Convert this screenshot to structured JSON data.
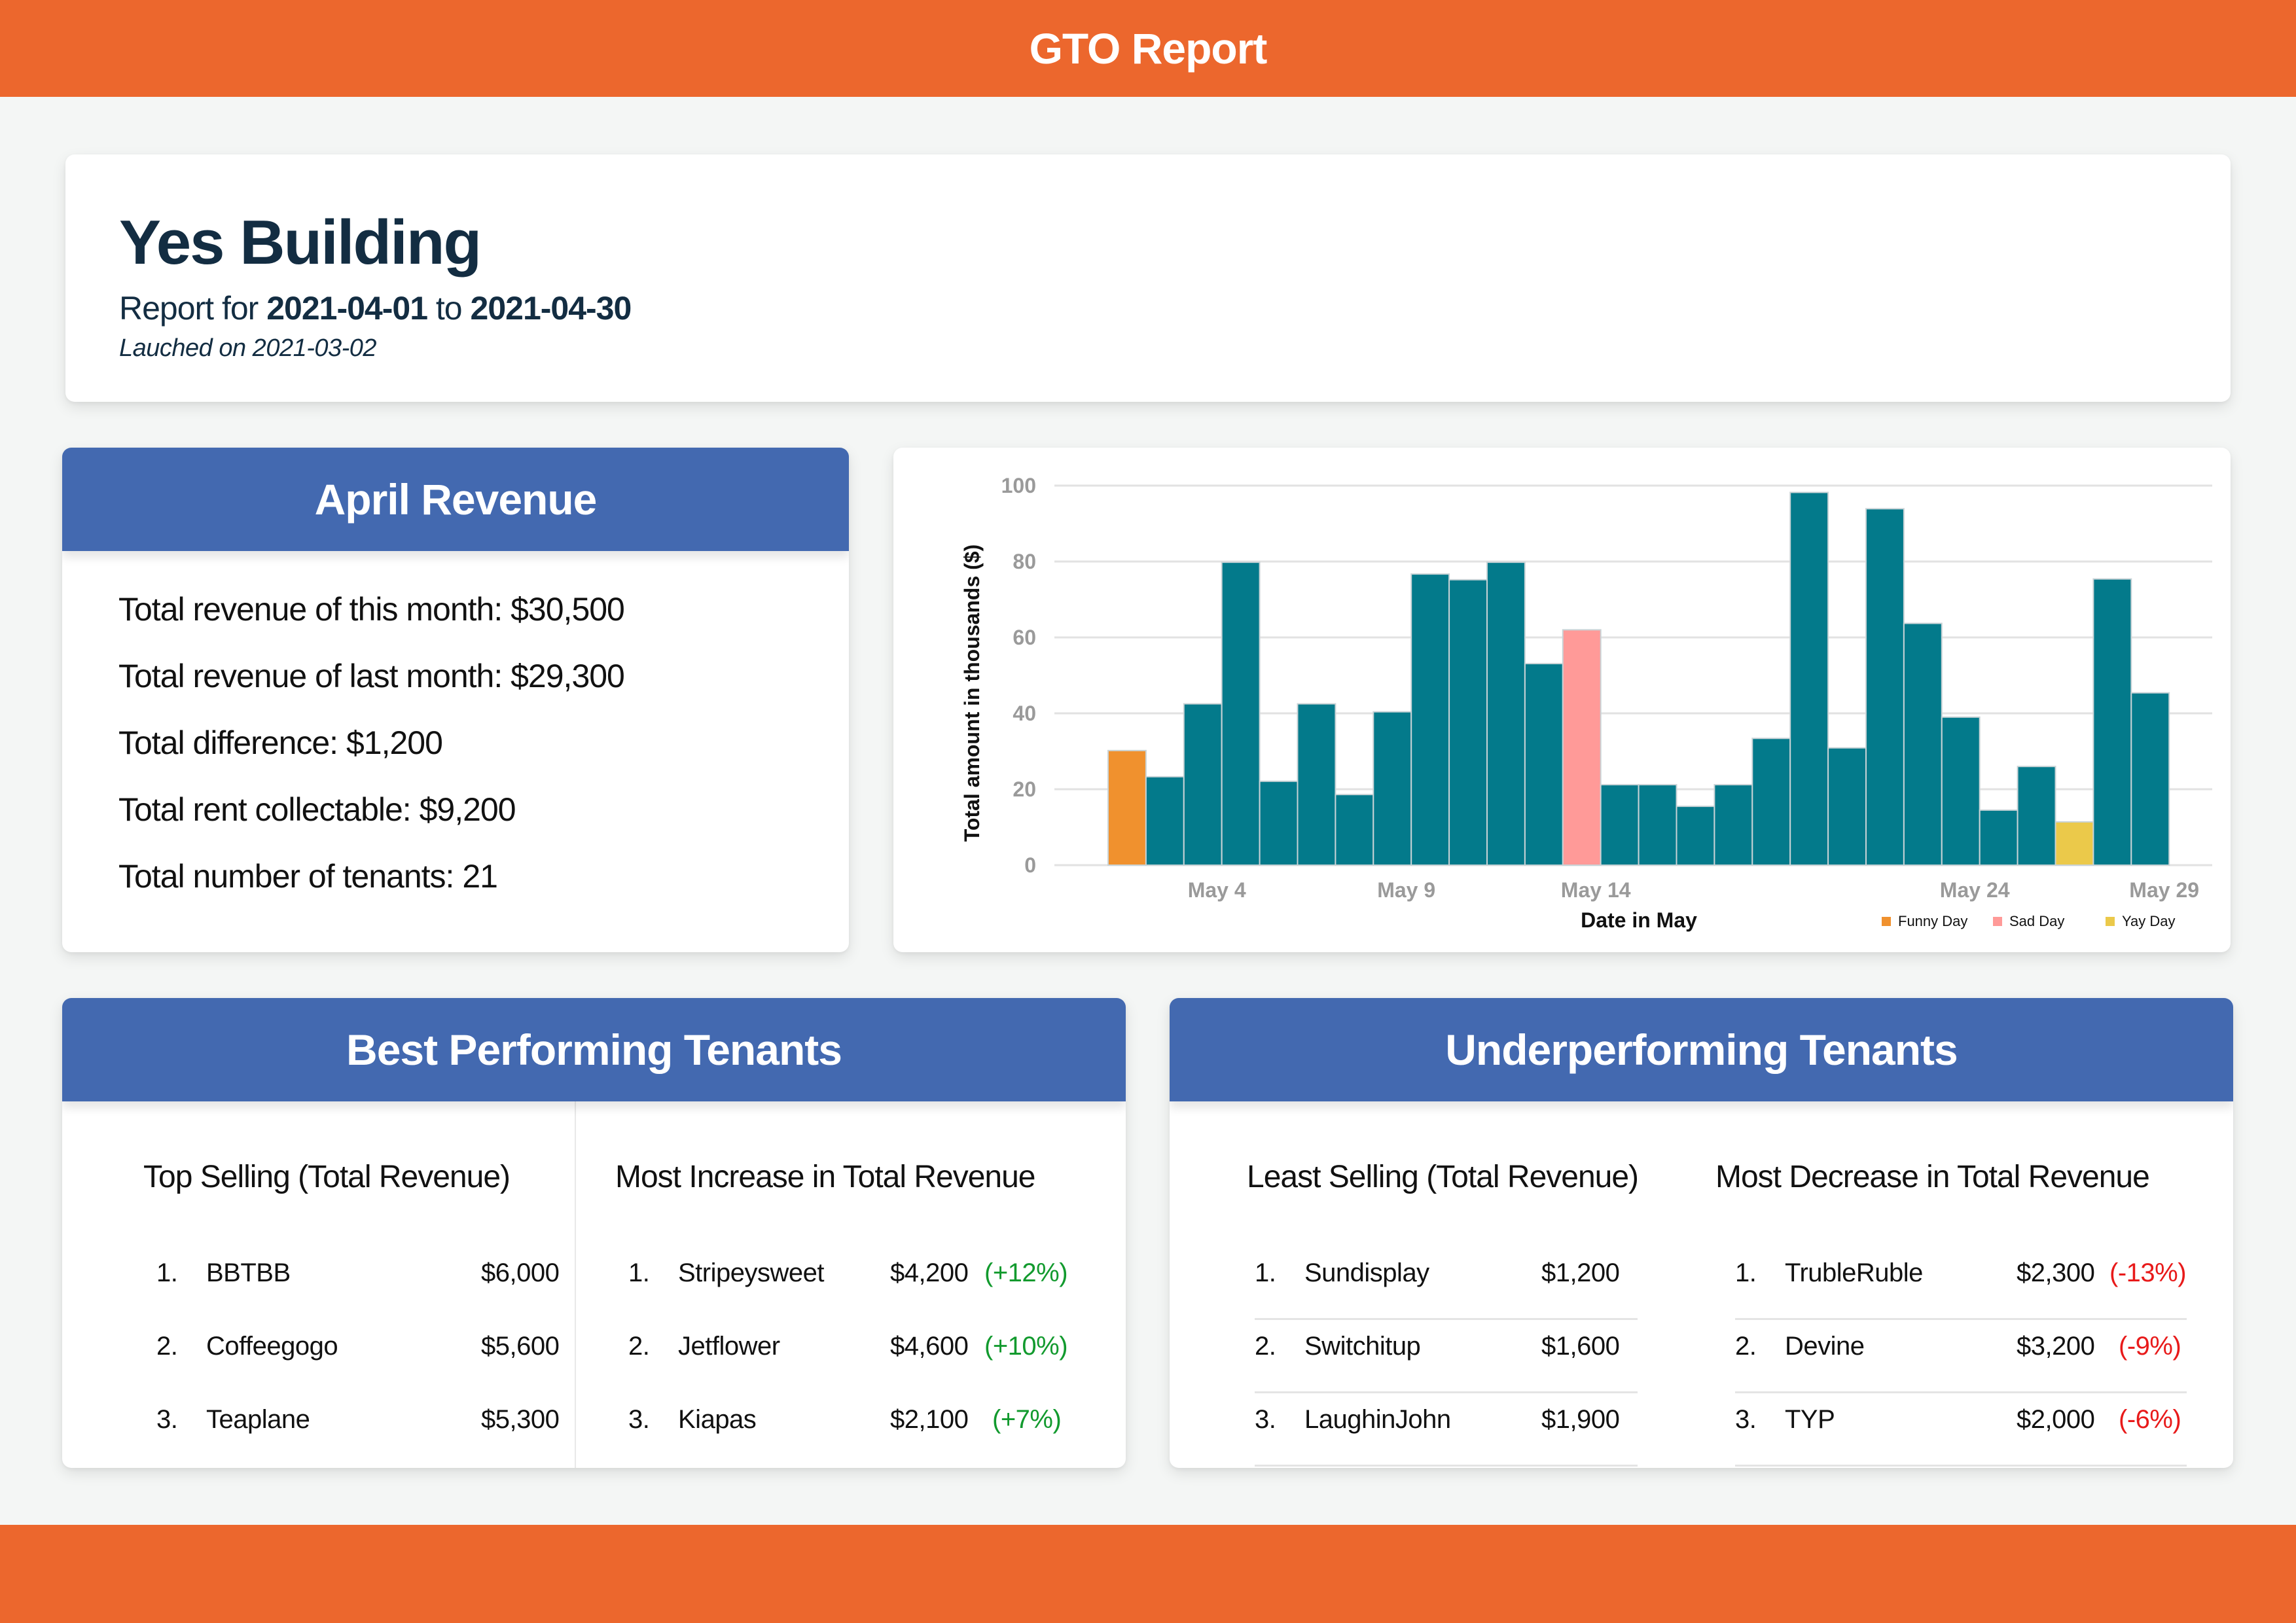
{
  "header": {
    "title": "GTO Report"
  },
  "summary": {
    "building_name": "Yes Building",
    "report_prefix": "Report for",
    "start_date": "2021-04-01",
    "range_separator": "to",
    "end_date": "2021-04-30",
    "launch_text": "Lauched on 2021-03-02"
  },
  "revenue": {
    "title": "April Revenue",
    "lines": [
      "Total revenue of this month: $30,500",
      "Total revenue of last month: $29,300",
      "Total difference: $1,200",
      "Total rent collectable: $9,200",
      "Total number of tenants: 21"
    ]
  },
  "colors": {
    "brand_orange": "#EC672D",
    "card_header_blue": "#4369B0",
    "bar_default": "#037A8B",
    "positive": "#129A2E",
    "negative": "#E81A1A"
  },
  "chart_data": {
    "type": "bar",
    "title": "",
    "xlabel": "Date in May",
    "ylabel": "Total amount in thousands ($)",
    "ylim": [
      0,
      100
    ],
    "yticks": [
      0,
      20,
      40,
      60,
      80,
      100
    ],
    "grid": true,
    "legend_position": "bottom-right",
    "x": [
      "May 1",
      "May 2",
      "May 3",
      "May 4",
      "May 5",
      "May 6",
      "May 7",
      "May 8",
      "May 9",
      "May 10",
      "May 11",
      "May 12",
      "May 13",
      "May 14",
      "May 15",
      "May 16",
      "May 17",
      "May 18",
      "May 19",
      "May 20",
      "May 21",
      "May 22",
      "May 23",
      "May 24",
      "May 25",
      "May 26",
      "May 27",
      "May 28"
    ],
    "values": [
      30.2,
      23.3,
      42.5,
      79.8,
      22.1,
      42.5,
      18.6,
      40.4,
      76.7,
      75.2,
      79.8,
      53.1,
      62.0,
      21.2,
      21.2,
      15.5,
      21.2,
      33.4,
      98.2,
      30.9,
      93.9,
      63.7,
      39.0,
      14.5,
      26.0,
      11.4,
      75.4,
      45.4
    ],
    "categories_per_bar": [
      "Funny Day",
      "",
      "",
      "",
      "",
      "",
      "",
      "",
      "",
      "",
      "",
      "",
      "Sad Day",
      "",
      "",
      "",
      "",
      "",
      "",
      "",
      "",
      "",
      "",
      "",
      "",
      "Yay Day",
      "",
      ""
    ],
    "xtick_labels": [
      {
        "label": "May 4",
        "day": 4
      },
      {
        "label": "May 9",
        "day": 9
      },
      {
        "label": "May 14",
        "day": 14
      },
      {
        "label": "May 24",
        "day": 24
      },
      {
        "label": "May 29",
        "day": 29
      }
    ],
    "legend": [
      {
        "name": "Funny Day",
        "color": "#F0912E"
      },
      {
        "name": "Sad Day",
        "color": "#FF9A98"
      },
      {
        "name": "Yay Day",
        "color": "#EBC94A"
      }
    ]
  },
  "best": {
    "title": "Best Performing Tenants",
    "top_selling": {
      "title": "Top Selling (Total Revenue)",
      "rows": [
        {
          "rank": "1.",
          "name": "BBTBB",
          "amount": "$6,000"
        },
        {
          "rank": "2.",
          "name": "Coffeegogo",
          "amount": "$5,600"
        },
        {
          "rank": "3.",
          "name": "Teaplane",
          "amount": "$5,300"
        }
      ]
    },
    "most_increase": {
      "title": "Most Increase in Total Revenue",
      "rows": [
        {
          "rank": "1.",
          "name": "Stripeysweet",
          "amount": "$4,200",
          "change": "(+12%)"
        },
        {
          "rank": "2.",
          "name": "Jetflower",
          "amount": "$4,600",
          "change": "(+10%)"
        },
        {
          "rank": "3.",
          "name": "Kiapas",
          "amount": "$2,100",
          "change": "(+7%)"
        }
      ]
    }
  },
  "under": {
    "title": "Underperforming Tenants",
    "least_selling": {
      "title": "Least Selling (Total Revenue)",
      "rows": [
        {
          "rank": "1.",
          "name": "Sundisplay",
          "amount": "$1,200"
        },
        {
          "rank": "2.",
          "name": "Switchitup",
          "amount": "$1,600"
        },
        {
          "rank": "3.",
          "name": "LaughinJohn",
          "amount": "$1,900"
        }
      ]
    },
    "most_decrease": {
      "title": "Most Decrease in Total Revenue",
      "rows": [
        {
          "rank": "1.",
          "name": "TrubleRuble",
          "amount": "$2,300",
          "change": "(-13%)"
        },
        {
          "rank": "2.",
          "name": "Devine",
          "amount": "$3,200",
          "change": "(-9%)"
        },
        {
          "rank": "3.",
          "name": "TYP",
          "amount": "$2,000",
          "change": "(-6%)"
        }
      ]
    }
  }
}
